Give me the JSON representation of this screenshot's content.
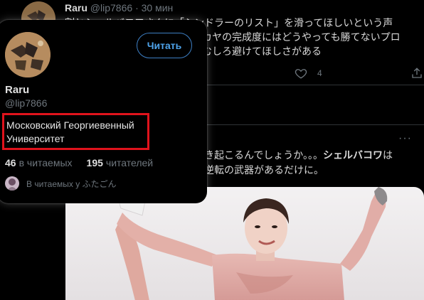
{
  "tweet_top": {
    "name": "Raru",
    "handle": "@lip7866",
    "time": "· 30 мин",
    "text_lines": [
      "割とシェルバコワさんに「シンドラーのリスト」を滑ってほしいという声",
      "カヤの完成度にはどうやっても勝てないプロ",
      "むしろ避けてほしさがある"
    ],
    "like_count": "4",
    "icons": {
      "like": "heart-icon",
      "share": "share-icon"
    }
  },
  "tweet_bottom": {
    "more_label": "···",
    "text_lines": [
      {
        "before": "き起こるんでしょうか。。。",
        "bold": "シェルバコワ",
        "after": "は"
      },
      {
        "before": "逆転の武器があるだけに。",
        "bold": "",
        "after": ""
      }
    ],
    "photo_label": "figure-skater-photo"
  },
  "hover_card": {
    "follow_label": "Читать",
    "name": "Raru",
    "handle": "@lip7866",
    "bio": "Московский Георгиевенный Университет",
    "following_count": "46",
    "following_label": "в читаемых",
    "followers_count": "195",
    "followers_label": "читателей",
    "mutual_text": "В читаемых у ふたごん"
  },
  "colors": {
    "background": "#000000",
    "accent": "#4ea3ea",
    "highlight_border": "#e0131c",
    "muted": "#6e767d"
  }
}
